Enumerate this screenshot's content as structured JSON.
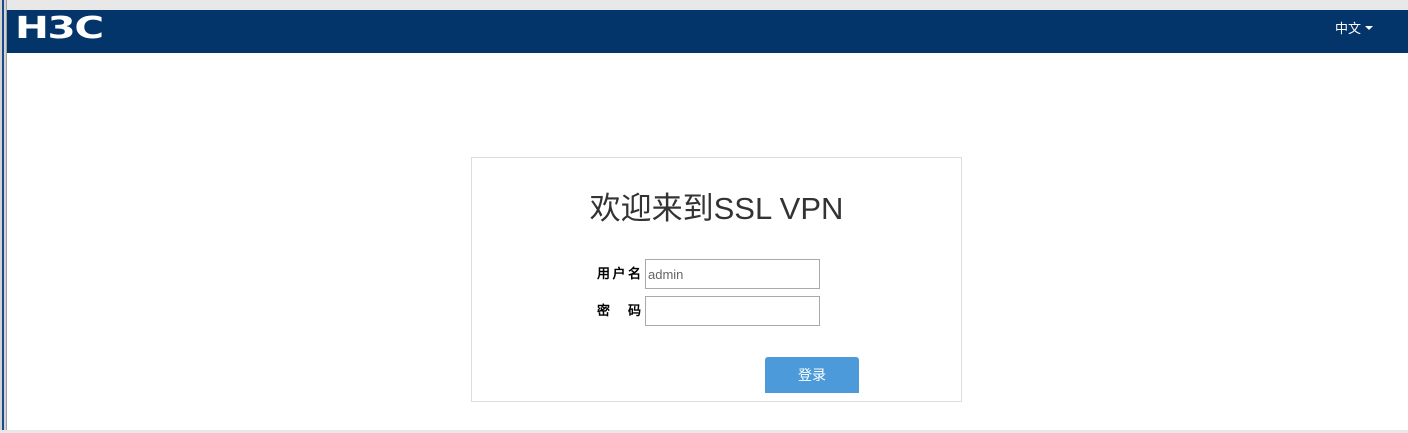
{
  "header": {
    "logo_text": "H3C",
    "language_label": "中文",
    "background_color": "#03356b"
  },
  "login": {
    "title": "欢迎来到SSL VPN",
    "username_label": "用户名",
    "username_value": "admin",
    "password_label": "密 码",
    "password_value": "",
    "submit_label": "登录",
    "button_color": "#4c9ad9"
  }
}
